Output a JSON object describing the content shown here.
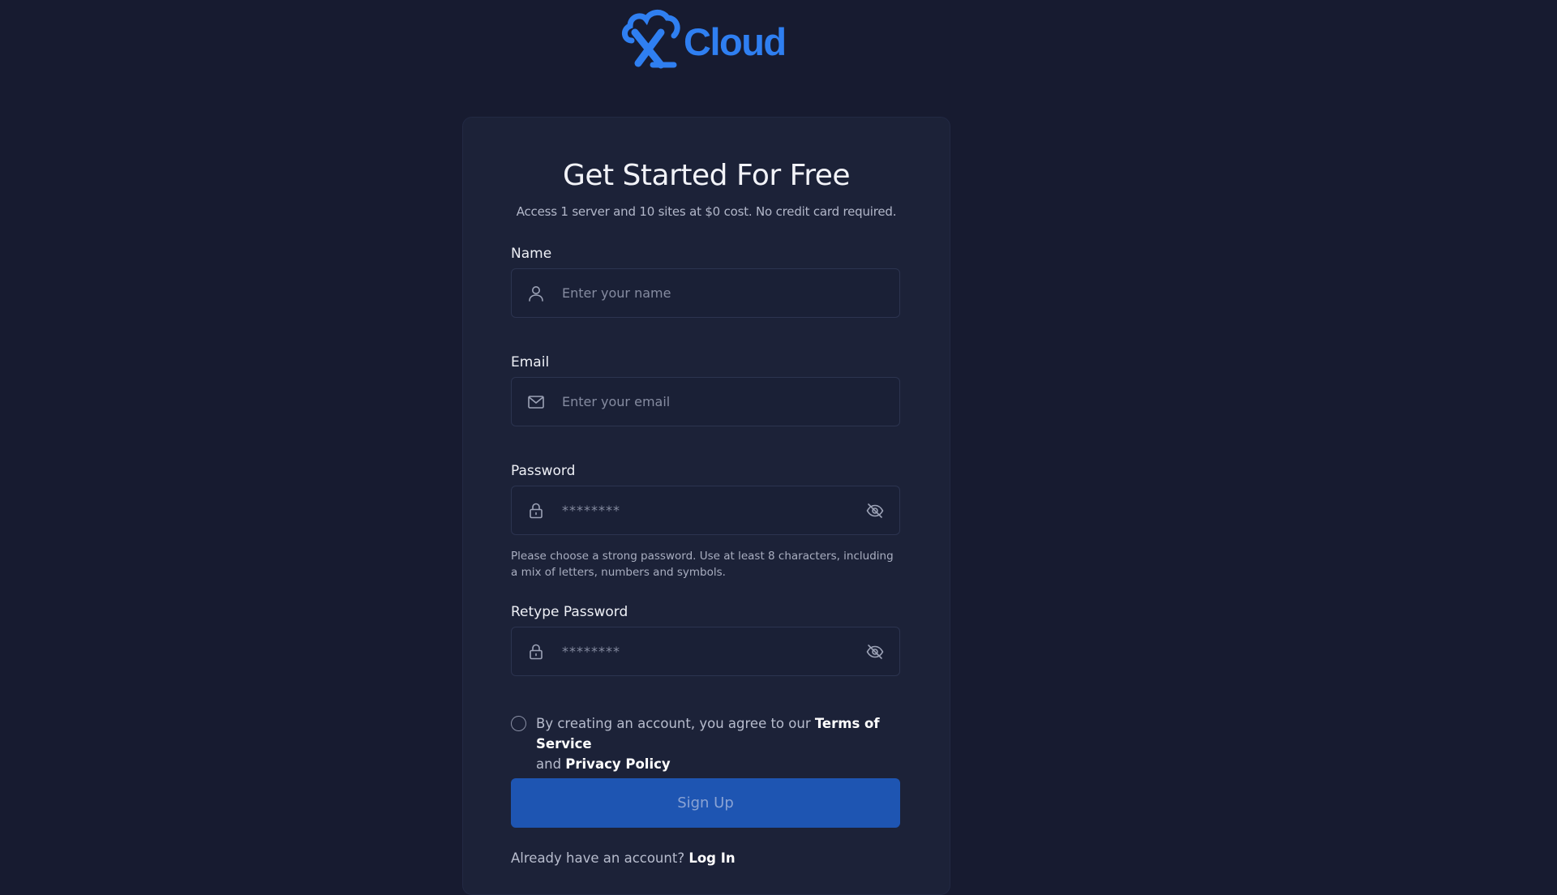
{
  "brand": {
    "name": "Cloud",
    "color": "#2f7ff1"
  },
  "form": {
    "title": "Get Started For Free",
    "subtitle": "Access 1 server and 10 sites at $0 cost. No credit card required.",
    "name": {
      "label": "Name",
      "placeholder": "Enter your name",
      "icon": "user-icon"
    },
    "email": {
      "label": "Email",
      "placeholder": "Enter your email",
      "icon": "mail-icon"
    },
    "password": {
      "label": "Password",
      "placeholder": "********",
      "icon": "lock-icon",
      "toggle_icon": "eye-off-icon",
      "hint": "Please choose a strong password. Use at least 8 characters, including a mix of letters, numbers and symbols."
    },
    "retype_password": {
      "label": "Retype Password",
      "placeholder": "********",
      "icon": "lock-icon",
      "toggle_icon": "eye-off-icon"
    },
    "agreement": {
      "checked": false,
      "text_before": "By creating an account, you agree to our ",
      "terms_link": "Terms of Service",
      "text_middle": " and ",
      "privacy_link": "Privacy Policy"
    },
    "submit_label": "Sign Up",
    "login_prompt": "Already have an account?",
    "login_link": "Log In"
  },
  "colors": {
    "background": "#171b30",
    "card": "#1c2238",
    "primary_button": "#1e55b2"
  }
}
